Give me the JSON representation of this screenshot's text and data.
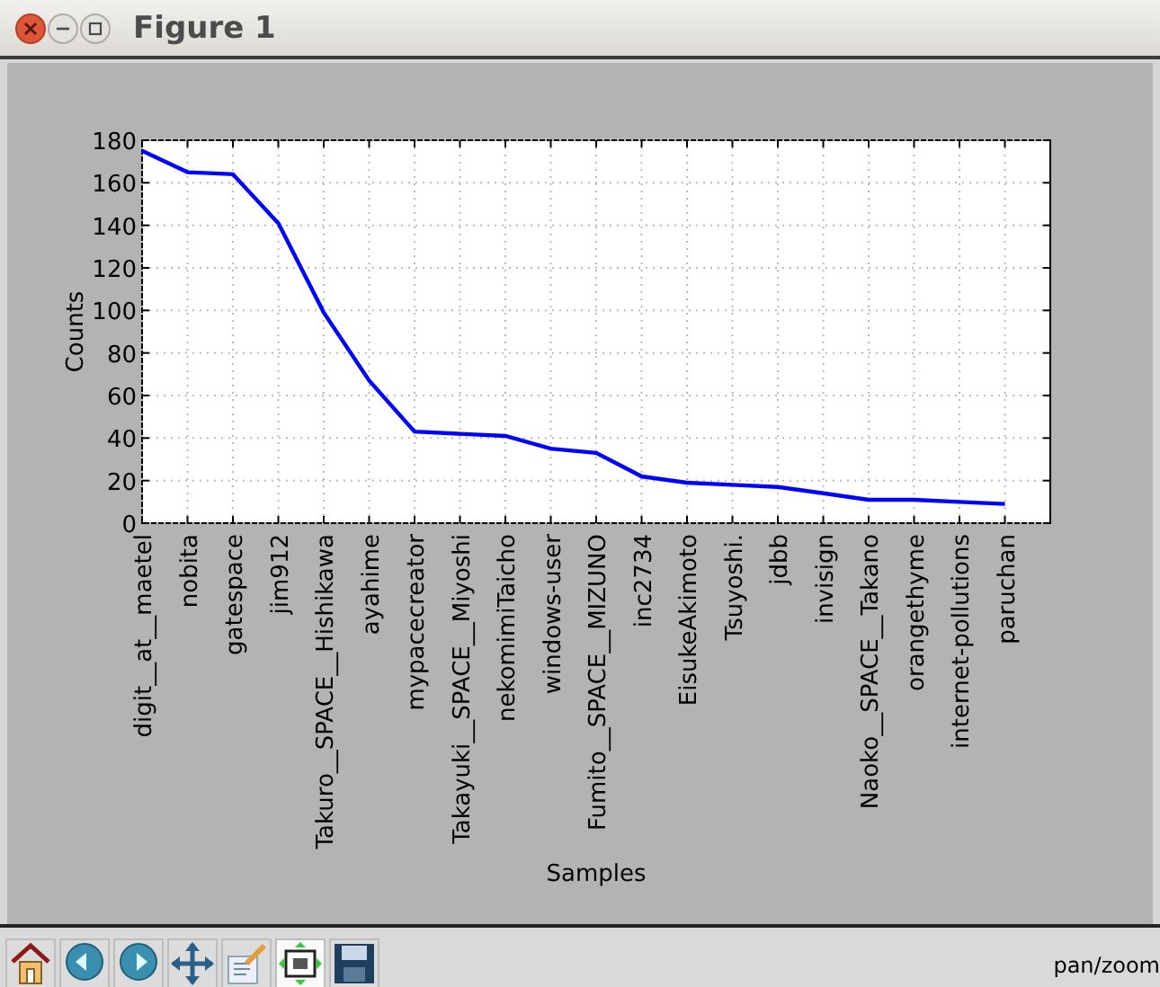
{
  "window": {
    "title": "Figure 1"
  },
  "figure": {
    "chart_data": {
      "type": "line",
      "xlabel": "Samples",
      "ylabel": "Counts",
      "categories": [
        "digit__at__maetel",
        "nobita",
        "gatespace",
        "jim912",
        "Takuro__SPACE__Hishikawa",
        "ayahime",
        "mypacecreator",
        "Takayuki__SPACE__Miyoshi",
        "nekomimiTaicho",
        "windows-user",
        "Fumito__SPACE__MIZUNO",
        "inc2734",
        "EisukeAkimoto",
        "Tsuyoshi.",
        "jdbb",
        "invisign",
        "Naoko__SPACE__Takano",
        "orangethyme",
        "internet-pollutions",
        "paruchan"
      ],
      "series": [
        {
          "color": "#0000ff",
          "values": [
            175,
            165,
            164,
            141,
            99,
            67,
            43,
            42,
            41,
            35,
            33,
            22,
            19,
            18,
            17,
            14,
            11,
            11,
            10,
            9
          ]
        }
      ],
      "grid": true,
      "ylim": [
        0,
        180
      ],
      "yticks": [
        0,
        20,
        40,
        60,
        80,
        100,
        120,
        140,
        160,
        180
      ]
    }
  },
  "toolbar": {
    "buttons": [
      {
        "kind": "home"
      },
      {
        "kind": "back"
      },
      {
        "kind": "forward"
      },
      {
        "kind": "pan"
      },
      {
        "kind": "configure"
      },
      {
        "kind": "zoom"
      },
      {
        "kind": "save"
      }
    ],
    "status": "pan/zoom"
  }
}
